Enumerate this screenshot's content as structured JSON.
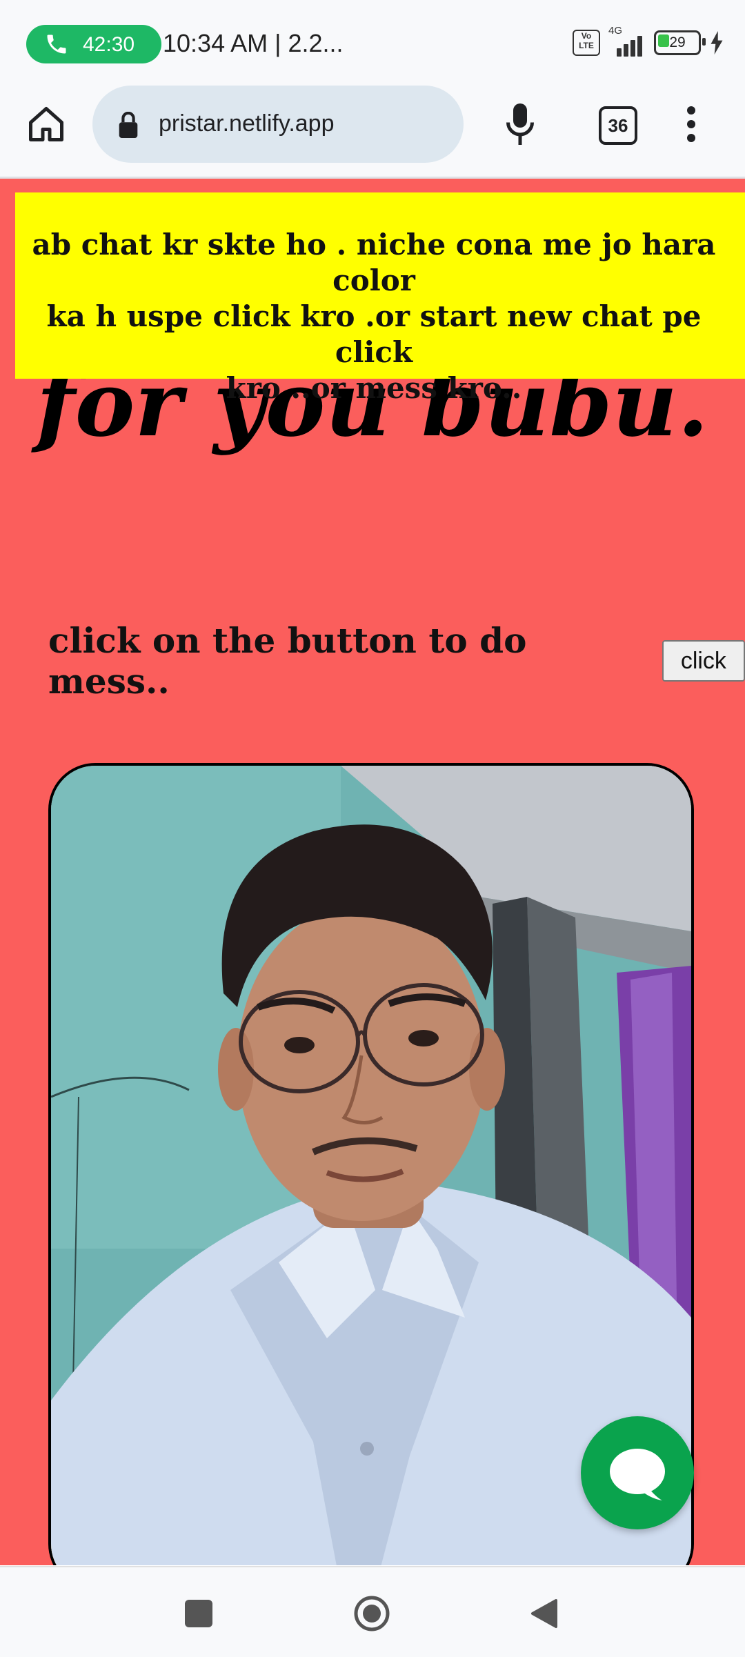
{
  "status_bar": {
    "call_timer": "42:30",
    "clock": "10:34 AM | 2.2...",
    "network": "4G",
    "volte": "Vo LTE",
    "battery": "29",
    "battery_level_percent": 29
  },
  "browser": {
    "url": "pristar.netlify.app",
    "tab_count": "36",
    "icons": [
      "home-icon",
      "lock-icon",
      "microphone-icon",
      "tab-switcher-icon",
      "more-vert-icon"
    ]
  },
  "page": {
    "notice_lines": [
      "ab chat kr skte ho . niche cona me jo hara color",
      "ka h uspe click kro .or start new chat pe click",
      "kro ..or mess kro.."
    ],
    "headline": "for you bubu.",
    "prompt": "click on the button to do mess..",
    "button_label": "click",
    "colors": {
      "background": "#fb5e5c",
      "notice": "#ffff00",
      "chat_button": "#0aa34d"
    }
  },
  "nav": {
    "icons": [
      "recent-apps-icon",
      "home-nav-icon",
      "back-icon"
    ]
  }
}
